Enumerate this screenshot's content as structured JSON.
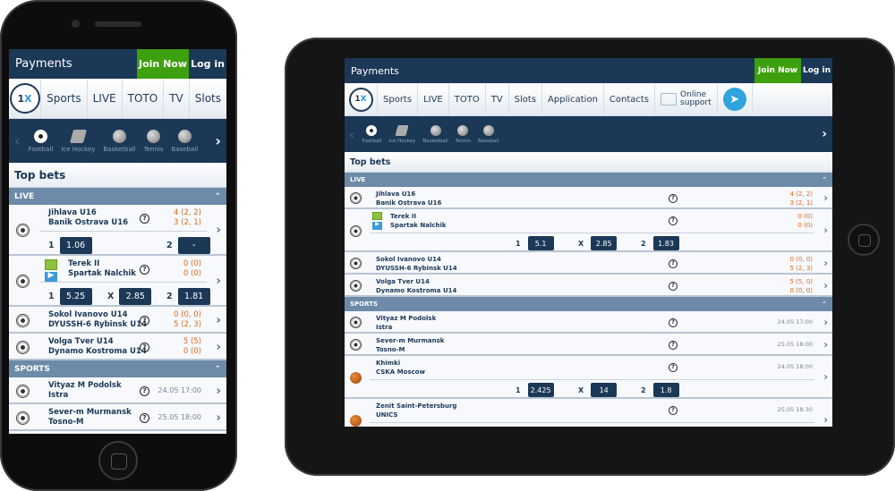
{
  "colors": {
    "header": "#1b3856",
    "join": "#3da00e",
    "section": "#6d8aa8",
    "score": "#e0651f"
  },
  "phone": {
    "header": {
      "title": "Payments",
      "join": "Join Now",
      "login": "Log in"
    },
    "nav": [
      "Sports",
      "LIVE",
      "TOTO",
      "TV",
      "Slots"
    ],
    "logo": "1X",
    "sports": [
      {
        "label": "Football",
        "icon": "football"
      },
      {
        "label": "Ice Hockey",
        "icon": "hockey"
      },
      {
        "label": "Basketball",
        "icon": "basketball"
      },
      {
        "label": "Tennis",
        "icon": "tennis"
      },
      {
        "label": "Baseball",
        "icon": "baseball"
      }
    ],
    "top_bets": "Top bets",
    "sections": [
      {
        "title": "LIVE",
        "rows": [
          {
            "icon": "football",
            "team1": "Jihlava U16",
            "team2": "Banik Ostrava U16",
            "s1": "4 (2, 2)",
            "s2": "3 (2, 1)",
            "odds": [
              {
                "label": "1",
                "value": "1.06"
              },
              {
                "label": "2",
                "value": "-"
              }
            ]
          },
          {
            "icon": "football",
            "badges": true,
            "team1": "Terek II",
            "team2": "Spartak Nalchik",
            "s1": "0 (0)",
            "s2": "0 (0)",
            "odds": [
              {
                "label": "1",
                "value": "5.25"
              },
              {
                "label": "X",
                "value": "2.85"
              },
              {
                "label": "2",
                "value": "1.81"
              }
            ]
          },
          {
            "icon": "football",
            "team1": "Sokol Ivanovo U14",
            "team2": "DYUSSH-6 Rybinsk U14",
            "s1": "0 (0, 0)",
            "s2": "5 (2, 3)"
          },
          {
            "icon": "football",
            "team1": "Volga Tver U14",
            "team2": "Dynamo Kostroma U14",
            "s1": "5 (5)",
            "s2": "0 (0)"
          }
        ]
      },
      {
        "title": "SPORTS",
        "rows": [
          {
            "icon": "football",
            "team1": "Vityaz M Podolsk",
            "team2": "Istra",
            "time": "24.05 17:00"
          },
          {
            "icon": "football",
            "team1": "Sever-m Murmansk",
            "team2": "Tosno-M",
            "time": "25.05 18:00"
          }
        ]
      }
    ]
  },
  "tablet": {
    "header": {
      "title": "Payments",
      "join": "Join Now",
      "login": "Log in"
    },
    "nav": [
      "Sports",
      "LIVE",
      "TOTO",
      "TV",
      "Slots",
      "Application",
      "Contacts"
    ],
    "support": [
      "Online",
      "support"
    ],
    "logo": "1X",
    "sports": [
      {
        "label": "Football",
        "icon": "football"
      },
      {
        "label": "Ice Hockey",
        "icon": "hockey"
      },
      {
        "label": "Basketball",
        "icon": "basketball"
      },
      {
        "label": "Tennis",
        "icon": "tennis"
      },
      {
        "label": "Baseball",
        "icon": "baseball"
      }
    ],
    "top_bets": "Top bets",
    "sections": [
      {
        "title": "LIVE",
        "rows": [
          {
            "icon": "football",
            "team1": "Jihlava U16",
            "team2": "Banik Ostrava U16",
            "s1": "4 (2, 2)",
            "s2": "3 (2, 1)"
          },
          {
            "icon": "football",
            "badges": true,
            "team1": "Terek II",
            "team2": "Spartak Nalchik",
            "s1": "0 (0)",
            "s2": "0 (0)",
            "odds": [
              {
                "label": "1",
                "value": "5.1"
              },
              {
                "label": "X",
                "value": "2.85"
              },
              {
                "label": "2",
                "value": "1.83"
              }
            ]
          },
          {
            "icon": "football",
            "team1": "Sokol Ivanovo U14",
            "team2": "DYUSSH-6 Rybinsk U14",
            "s1": "0 (0, 0)",
            "s2": "5 (2, 3)"
          },
          {
            "icon": "football",
            "team1": "Volga Tver U14",
            "team2": "Dynamo Kostroma U14",
            "s1": "5 (5, 0)",
            "s2": "0 (0, 0)"
          }
        ]
      },
      {
        "title": "SPORTS",
        "rows": [
          {
            "icon": "football",
            "team1": "Vityaz M Podolsk",
            "team2": "Istra",
            "time": "24.05 17:00"
          },
          {
            "icon": "football",
            "team1": "Sever-m Murmansk",
            "team2": "Tosno-M",
            "time": "25.05 18:00"
          },
          {
            "icon": "basketball",
            "team1": "Khimki",
            "team2": "CSKA Moscow",
            "time": "24.05 18:00",
            "odds": [
              {
                "label": "1",
                "value": "2.425"
              },
              {
                "label": "X",
                "value": "14"
              },
              {
                "label": "2",
                "value": "1.8"
              }
            ]
          },
          {
            "icon": "basketball",
            "team1": "Zenit Saint-Petersburg",
            "team2": "UNICS",
            "time": "25.05 18:30",
            "odds": []
          }
        ]
      }
    ]
  }
}
